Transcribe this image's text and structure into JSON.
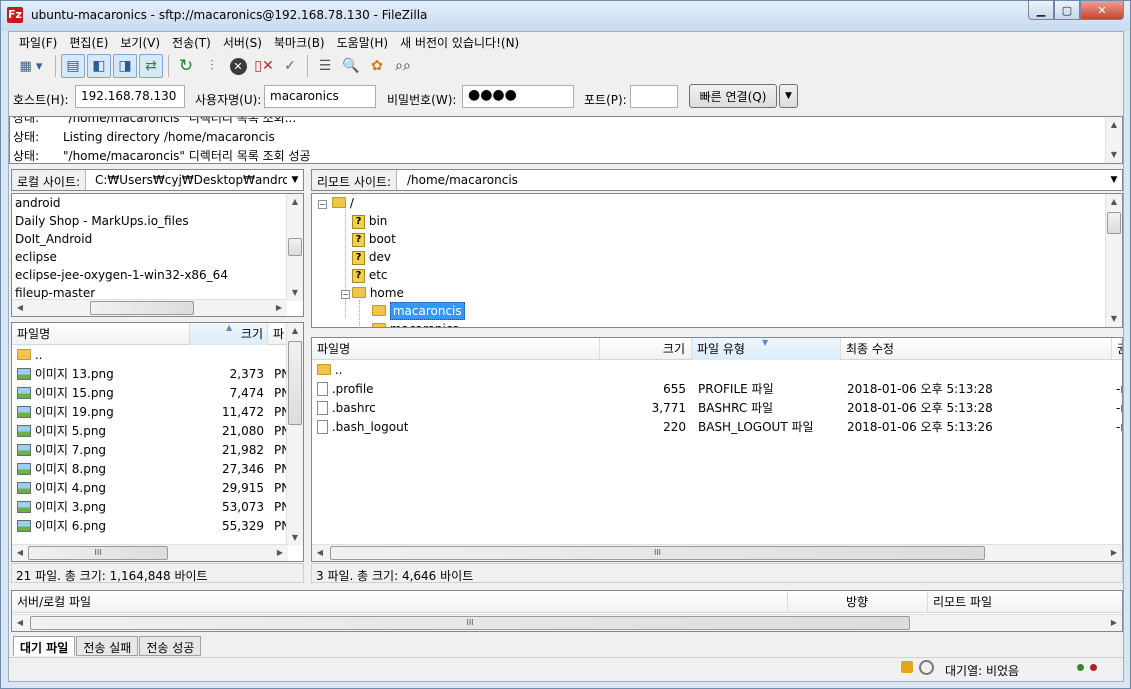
{
  "window": {
    "title": "ubuntu-macaronics - sftp://macaronics@192.168.78.130 - FileZilla",
    "app_icon": "Fz"
  },
  "menu": [
    "파일(F)",
    "편집(E)",
    "보기(V)",
    "전송(T)",
    "서버(S)",
    "북마크(B)",
    "도움말(H)",
    "새 버전이 있습니다!(N)"
  ],
  "quickconnect": {
    "host_label": "호스트(H):",
    "host_value": "192.168.78.130",
    "user_label": "사용자명(U):",
    "user_value": "macaronics",
    "pass_label": "비밀번호(W):",
    "pass_value": "●●●●",
    "port_label": "포트(P):",
    "port_value": "",
    "connect_label": "빠른 연결(Q)"
  },
  "log": [
    {
      "label": "상태:",
      "text": "\"/home/macaroncis\" 디렉터리 목록 조회..."
    },
    {
      "label": "상태:",
      "text": "Listing directory /home/macaroncis"
    },
    {
      "label": "상태:",
      "text": "\"/home/macaroncis\" 디렉터리 목록 조회 성공"
    }
  ],
  "local": {
    "site_label": "로컬 사이트:",
    "path": "C:₩Users₩cyj₩Desktop₩android₩",
    "tree": [
      "android",
      "Daily Shop - MarkUps.io_files",
      "DoIt_Android",
      "eclipse",
      "eclipse-jee-oxygen-1-win32-x86_64",
      "fileup-master"
    ],
    "columns": {
      "name": "파일명",
      "size": "크기",
      "type": "파"
    },
    "files": [
      {
        "name": "..",
        "size": "",
        "type": "",
        "icon": "folder"
      },
      {
        "name": "이미지 13.png",
        "size": "2,373",
        "type": "PN",
        "icon": "image"
      },
      {
        "name": "이미지 15.png",
        "size": "7,474",
        "type": "PN",
        "icon": "image"
      },
      {
        "name": "이미지 19.png",
        "size": "11,472",
        "type": "PN",
        "icon": "image"
      },
      {
        "name": "이미지 5.png",
        "size": "21,080",
        "type": "PN",
        "icon": "image"
      },
      {
        "name": "이미지 7.png",
        "size": "21,982",
        "type": "PN",
        "icon": "image"
      },
      {
        "name": "이미지 8.png",
        "size": "27,346",
        "type": "PN",
        "icon": "image"
      },
      {
        "name": "이미지 4.png",
        "size": "29,915",
        "type": "PN",
        "icon": "image"
      },
      {
        "name": "이미지 3.png",
        "size": "53,073",
        "type": "PN",
        "icon": "image"
      },
      {
        "name": "이미지 6.png",
        "size": "55,329",
        "type": "PN",
        "icon": "image"
      }
    ],
    "status": "21 파일. 총 크기: 1,164,848 바이트"
  },
  "remote": {
    "site_label": "리모트 사이트:",
    "path": "/home/macaroncis",
    "tree": [
      {
        "name": "/",
        "icon": "folder",
        "level": 0
      },
      {
        "name": "bin",
        "icon": "question",
        "level": 1
      },
      {
        "name": "boot",
        "icon": "question",
        "level": 1
      },
      {
        "name": "dev",
        "icon": "question",
        "level": 1
      },
      {
        "name": "etc",
        "icon": "question",
        "level": 1
      },
      {
        "name": "home",
        "icon": "folder",
        "level": 1
      },
      {
        "name": "macaroncis",
        "icon": "folder",
        "level": 2,
        "selected": true
      },
      {
        "name": "macaronics",
        "icon": "folder",
        "level": 2
      }
    ],
    "columns": {
      "name": "파일명",
      "size": "크기",
      "type": "파일 유형",
      "modified": "최종 수정",
      "perm": "권"
    },
    "files": [
      {
        "name": "..",
        "size": "",
        "type": "",
        "modified": "",
        "perm": "",
        "icon": "folder"
      },
      {
        "name": ".profile",
        "size": "655",
        "type": "PROFILE 파일",
        "modified": "2018-01-06 오후 5:13:28",
        "perm": "-r",
        "icon": "file"
      },
      {
        "name": ".bashrc",
        "size": "3,771",
        "type": "BASHRC 파일",
        "modified": "2018-01-06 오후 5:13:28",
        "perm": "-r",
        "icon": "file"
      },
      {
        "name": ".bash_logout",
        "size": "220",
        "type": "BASH_LOGOUT 파일",
        "modified": "2018-01-06 오후 5:13:26",
        "perm": "-r",
        "icon": "file"
      }
    ],
    "status": "3 파일. 총 크기: 4,646 바이트"
  },
  "queue": {
    "col_file": "서버/로컬 파일",
    "col_direction": "방향",
    "col_remote": "리모트 파일",
    "tabs": [
      "대기 파일",
      "전송 실패",
      "전송 성공"
    ]
  },
  "statusbar": {
    "queue_text": "대기열: 비었음"
  },
  "scroll_glyph": "III"
}
